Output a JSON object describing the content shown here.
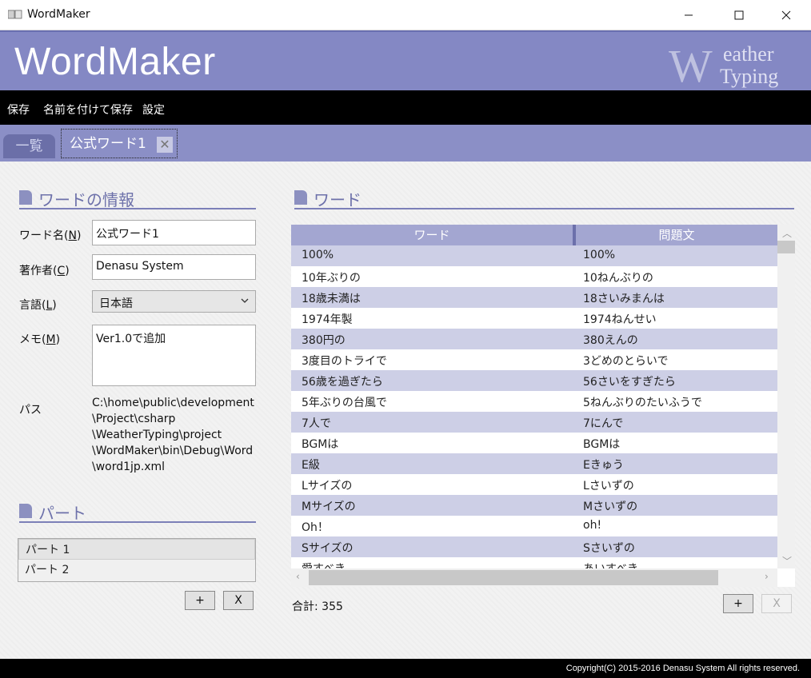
{
  "window": {
    "title": "WordMaker",
    "icon": "book-icon"
  },
  "header": {
    "app_title": "WordMaker",
    "logo_text_1": "W",
    "logo_text_2": "eather",
    "logo_text_3": "Typing"
  },
  "menu": {
    "items": [
      "保存",
      "名前を付けて保存",
      "設定"
    ]
  },
  "tabs": {
    "list_tab": "一覧",
    "active_tab": "公式ワード1",
    "close_glyph": "✕"
  },
  "info": {
    "section_title": "ワードの情報",
    "word_name_label": "ワード名(",
    "word_name_key": "N",
    "word_name_value": "公式ワード1",
    "author_label": "著作者(",
    "author_key": "C",
    "author_value": "Denasu System",
    "language_label": "言語(",
    "language_key": "L",
    "language_value": "日本語",
    "memo_label": "メモ(",
    "memo_key": "M",
    "memo_value": "Ver1.0で追加",
    "path_label": "パス",
    "path_lines": [
      "C:\\home\\public\\development",
      "\\Project\\csharp",
      "\\WeatherTyping\\project",
      "\\WordMaker\\bin\\Debug\\Word",
      "\\word1jp.xml"
    ]
  },
  "parts": {
    "section_title": "パート",
    "items": [
      "パート 1",
      "パート 2"
    ],
    "add_label": "+",
    "remove_label": "X"
  },
  "words": {
    "section_title": "ワード",
    "col_word": "ワード",
    "col_question": "問題文",
    "rows": [
      [
        "100%",
        "100%"
      ],
      [
        "10年ぶりの",
        "10ねんぶりの"
      ],
      [
        "18歳未満は",
        "18さいみまんは"
      ],
      [
        "1974年製",
        "1974ねんせい"
      ],
      [
        "380円の",
        "380えんの"
      ],
      [
        "3度目のトライで",
        "3どめのとらいで"
      ],
      [
        "56歳を過ぎたら",
        "56さいをすぎたら"
      ],
      [
        "5年ぶりの台風で",
        "5ねんぶりのたいふうで"
      ],
      [
        "7人で",
        "7にんで"
      ],
      [
        "BGMは",
        "BGMは"
      ],
      [
        "E級",
        "Eきゅう"
      ],
      [
        "Lサイズの",
        "Lさいずの"
      ],
      [
        "Mサイズの",
        "Mさいずの"
      ],
      [
        "Oh！",
        "oh!"
      ],
      [
        "Sサイズの",
        "Sさいずの"
      ],
      [
        "愛すべき",
        "あいすべき"
      ]
    ],
    "total_label": "合計: 355",
    "add_label": "+",
    "remove_label": "X"
  },
  "footer": {
    "copyright": "Copyright(C) 2015-2016 Denasu System All rights reserved."
  },
  "colors": {
    "header": "#8488c4",
    "tabstrip": "#8b8fc6",
    "row_alt": "#cdcfe6",
    "grid_header": "#a3a6d1"
  }
}
